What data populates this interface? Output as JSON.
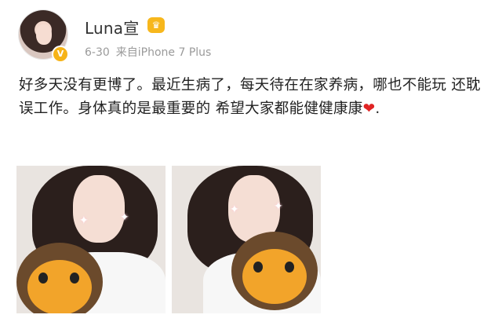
{
  "user": {
    "name": "Luna宣",
    "verified_badge": "V",
    "vip_badge": "♛"
  },
  "post": {
    "date": "6-30",
    "source": "来自iPhone 7 Plus",
    "text": "好多天没有更博了。最近生病了，每天待在在家养病，哪也不能玩 还耽误工作。身体真的是最重要的 希望大家都能健健康康",
    "end_punct": ".",
    "heart_emoji": "❤"
  },
  "colors": {
    "username": "#333333",
    "meta": "#9a9a9a",
    "text": "#222222",
    "heart": "#e02424",
    "badge": "#f6b318"
  }
}
